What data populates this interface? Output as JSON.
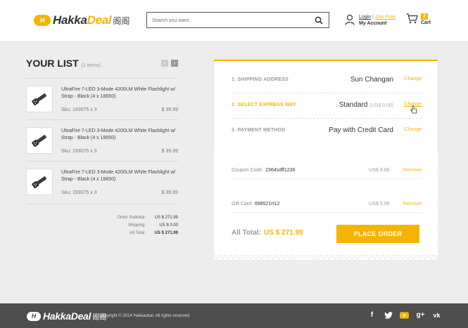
{
  "header": {
    "logo_mark": "H",
    "logo_text_a": "Hakka",
    "logo_text_b": "Deal",
    "logo_cn": "阁阁",
    "search_placeholder": "Search you want..",
    "login": "Login",
    "separator": "|",
    "join": "Join Free",
    "my_account": "My Account",
    "cart_count": "2",
    "cart_label": "Cart"
  },
  "list": {
    "title": "YOUR LIST",
    "count": "(1 items)",
    "prev": "‹",
    "next": "›",
    "items": [
      {
        "name": "UltraFire 7-LED 3-Mode 4200LM White Flashlight w/ Strap - Black (4 x 18650)",
        "sku": "Sku: 193075  x  3",
        "price": "$ 39.99"
      },
      {
        "name": "UltraFire 7-LED 3-Mode 4200LM White Flashlight w/ Strap - Black (4 x 18650)",
        "sku": "Sku: 193075  x  3",
        "price": "$ 39.99"
      },
      {
        "name": "UltraFire 7-LED 3-Mode 4200LM White Flashlight w/ Strap - Black (4 x 18650)",
        "sku": "Sku: 193075  x  3",
        "price": "$ 39.99"
      }
    ],
    "totals": [
      {
        "label": "Order Subtotal:",
        "value": "US $ 271.99",
        "bold": false
      },
      {
        "label": "Shipping:",
        "value": "US $ 0.00",
        "bold": false
      },
      {
        "label": "All Total:",
        "value": "US $ 271.99",
        "bold": true
      }
    ]
  },
  "checkout": {
    "steps": [
      {
        "label": "1. SHIPPING ADDRESS",
        "value": "Sun Changan",
        "sub": "",
        "action": "Change",
        "active": false
      },
      {
        "label": "2. SELECT EXPRESS WAY",
        "value": "Standard",
        "sub": "(US$ 0.00)",
        "action": "Change",
        "active": true
      },
      {
        "label": "3. PAYMENT METHOD",
        "value": "Pay with Credit Card",
        "sub": "",
        "action": "Change",
        "active": false
      }
    ],
    "coupon": {
      "label": "Coupon Code:",
      "code": "2364sdff1236",
      "amount": "-US$ 9.00",
      "action": "Remove"
    },
    "gift": {
      "label": "Gift Card:",
      "code": "698521rt12",
      "amount": "-US$ 5.99",
      "action": "Remove"
    },
    "all_total_label": "All Total:",
    "all_total_value": "US $ 271.99",
    "place_order": "PLACE ORDER"
  },
  "footer": {
    "logo_mark": "H",
    "logo_text": "HakkaDeal",
    "logo_cn": "阁阁",
    "copyright": "Copyright © 2014 Hakkadeal. All rights reserved.",
    "social": [
      {
        "name": "facebook-icon",
        "glyph": "f"
      },
      {
        "name": "twitter-icon",
        "glyph": "t"
      },
      {
        "name": "youtube-icon",
        "glyph": "▶"
      },
      {
        "name": "google-plus-icon",
        "glyph": "g+"
      },
      {
        "name": "vk-icon",
        "glyph": "vk"
      }
    ]
  },
  "colors": {
    "accent": "#f6b400",
    "footer": "#4e4e4e",
    "background": "#ededed"
  }
}
